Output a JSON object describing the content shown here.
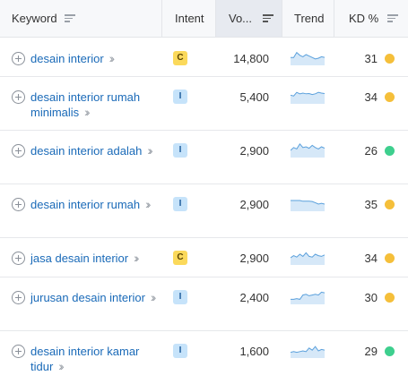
{
  "header": {
    "keyword": "Keyword",
    "intent": "Intent",
    "volume": "Vo...",
    "trend": "Trend",
    "kd": "KD %"
  },
  "rows": [
    {
      "keyword": "desain interior",
      "intent": "C",
      "volume": "14,800",
      "kd": "31",
      "kd_color": "#f5bf3a",
      "trend": [
        0.55,
        0.55,
        0.9,
        0.7,
        0.6,
        0.75,
        0.65,
        0.55,
        0.45,
        0.5,
        0.6,
        0.55
      ]
    },
    {
      "keyword": "desain interior rumah minimalis",
      "intent": "I",
      "volume": "5,400",
      "kd": "34",
      "kd_color": "#f5bf3a",
      "trend": [
        0.6,
        0.55,
        0.8,
        0.7,
        0.75,
        0.7,
        0.72,
        0.65,
        0.7,
        0.8,
        0.75,
        0.72
      ]
    },
    {
      "keyword": "desain interior adalah",
      "intent": "I",
      "volume": "2,900",
      "kd": "26",
      "kd_color": "#3ecf8e",
      "trend": [
        0.5,
        0.7,
        0.6,
        0.95,
        0.7,
        0.75,
        0.65,
        0.85,
        0.7,
        0.6,
        0.75,
        0.65
      ]
    },
    {
      "keyword": "desain interior rumah",
      "intent": "I",
      "volume": "2,900",
      "kd": "35",
      "kd_color": "#f5bf3a",
      "trend": [
        0.75,
        0.75,
        0.75,
        0.75,
        0.7,
        0.7,
        0.7,
        0.68,
        0.6,
        0.5,
        0.55,
        0.5
      ]
    },
    {
      "keyword": "jasa desain interior",
      "intent": "C",
      "volume": "2,900",
      "kd": "34",
      "kd_color": "#f5bf3a",
      "trend": [
        0.5,
        0.65,
        0.55,
        0.75,
        0.6,
        0.85,
        0.6,
        0.55,
        0.75,
        0.65,
        0.6,
        0.7
      ]
    },
    {
      "keyword": "jurusan desain interior",
      "intent": "I",
      "volume": "2,400",
      "kd": "30",
      "kd_color": "#f5bf3a",
      "trend": [
        0.35,
        0.35,
        0.4,
        0.35,
        0.65,
        0.7,
        0.6,
        0.65,
        0.7,
        0.65,
        0.85,
        0.8
      ]
    },
    {
      "keyword": "desain interior kamar tidur",
      "intent": "I",
      "volume": "1,600",
      "kd": "29",
      "kd_color": "#3ecf8e",
      "trend": [
        0.4,
        0.45,
        0.4,
        0.45,
        0.5,
        0.45,
        0.7,
        0.55,
        0.8,
        0.5,
        0.6,
        0.55
      ]
    }
  ]
}
